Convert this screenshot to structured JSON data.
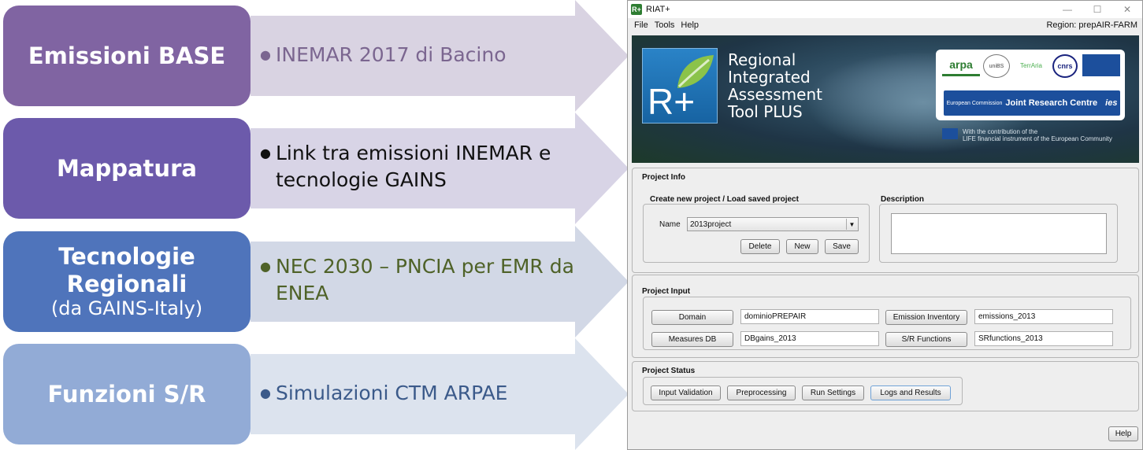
{
  "diagram": {
    "rows": [
      {
        "title": "Emissioni BASE",
        "subtitle": "",
        "box_color": "#8064a2",
        "arrow_color": "#d9d3e2",
        "bullet": "INEMAR 2017 di Bacino",
        "text_color": "#7b6690"
      },
      {
        "title": "Mappatura",
        "subtitle": "",
        "box_color": "#6c5aab",
        "arrow_color": "#d8d4e6",
        "bullet": "Link tra emissioni INEMAR e tecnologie GAINS",
        "text_color": "#111111"
      },
      {
        "title": "Tecnologie Regionali",
        "subtitle": "(da GAINS-Italy)",
        "box_color": "#4f74bb",
        "arrow_color": "#d2d8e6",
        "bullet": "NEC 2030 – PNCIA per EMR da ENEA",
        "text_color": "#4f6228"
      },
      {
        "title": "Funzioni S/R",
        "subtitle": "",
        "box_color": "#92abd6",
        "arrow_color": "#dce3ee",
        "bullet": "Simulazioni CTM ARPAE",
        "text_color": "#3b5a8a"
      }
    ]
  },
  "window": {
    "title": "RIAT+",
    "app_icon": "R+",
    "controls": {
      "minimize": "—",
      "maximize": "☐",
      "close": "✕"
    },
    "menu": [
      "File",
      "Tools",
      "Help"
    ],
    "region": "Region: prepAIR-FARM",
    "banner": {
      "logo_text": "R+",
      "brand_lines": [
        "Regional",
        "Integrated",
        "Assessment",
        "Tool PLUS"
      ],
      "partners": [
        "arpa",
        "uniBS",
        "TerrAria",
        "cnrs",
        ""
      ],
      "jrc": "Joint Research Centre",
      "jrc_prefix": "European Commission",
      "ies": "ies",
      "life_line1": "With the contribution of the",
      "life_line2": "LIFE financial instrument of the European Community"
    },
    "project_info": {
      "label": "Project Info",
      "create_label": "Create new project / Load saved project",
      "name_label": "Name",
      "name_value": "2013project",
      "buttons": {
        "delete": "Delete",
        "new": "New",
        "save": "Save"
      },
      "description_label": "Description"
    },
    "project_input": {
      "label": "Project Input",
      "domain_btn": "Domain",
      "domain_value": "dominioPREPAIR",
      "emission_btn": "Emission Inventory",
      "emission_value": "emissions_2013",
      "measures_btn": "Measures DB",
      "measures_value": "DBgains_2013",
      "sr_btn": "S/R Functions",
      "sr_value": "SRfunctions_2013"
    },
    "project_status": {
      "label": "Project Status",
      "buttons": [
        "Input Validation",
        "Preprocessing",
        "Run Settings",
        "Logs and Results"
      ]
    },
    "help_btn": "Help"
  }
}
